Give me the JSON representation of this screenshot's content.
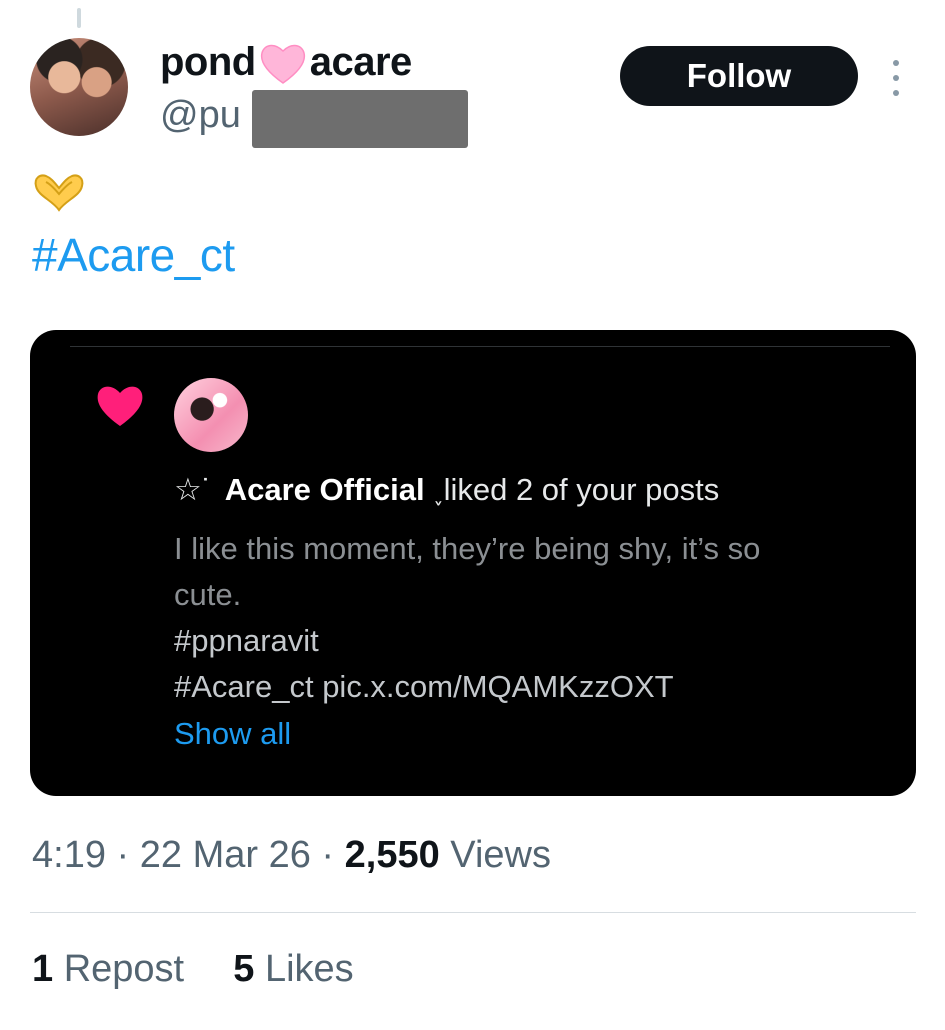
{
  "post": {
    "author": {
      "name_part1": "pond",
      "name_part2": "acare",
      "handle_prefix": "@pu",
      "avatar": "avatar-photo"
    },
    "follow_label": "Follow",
    "emoji": "heart-hands-icon",
    "hashtag": "#Acare_ct",
    "embedded_image": {
      "heart_icon": "pink-heart-icon",
      "star": "☆˙",
      "account_name": "Acare Official",
      "action_text": "˯liked 2 of your posts",
      "body_lines": [
        "I like this moment, they’re being shy, it’s so",
        "cute."
      ],
      "tag1": "#ppnaravit",
      "tag2_line": "#Acare_ct pic.x.com/MQAMKzzOXT",
      "show_all": "Show all"
    },
    "meta": {
      "time": "4:19",
      "sep1": "·",
      "date": "22 Mar 26",
      "sep2": "·",
      "views_count": "2,550",
      "views_label": "Views"
    },
    "stats": {
      "reposts_count": "1",
      "reposts_label": "Repost",
      "likes_count": "5",
      "likes_label": "Likes"
    }
  },
  "colors": {
    "link": "#1d9bf0",
    "pink": "#ff1f7a",
    "text": "#0f1419",
    "muted": "#536471"
  }
}
